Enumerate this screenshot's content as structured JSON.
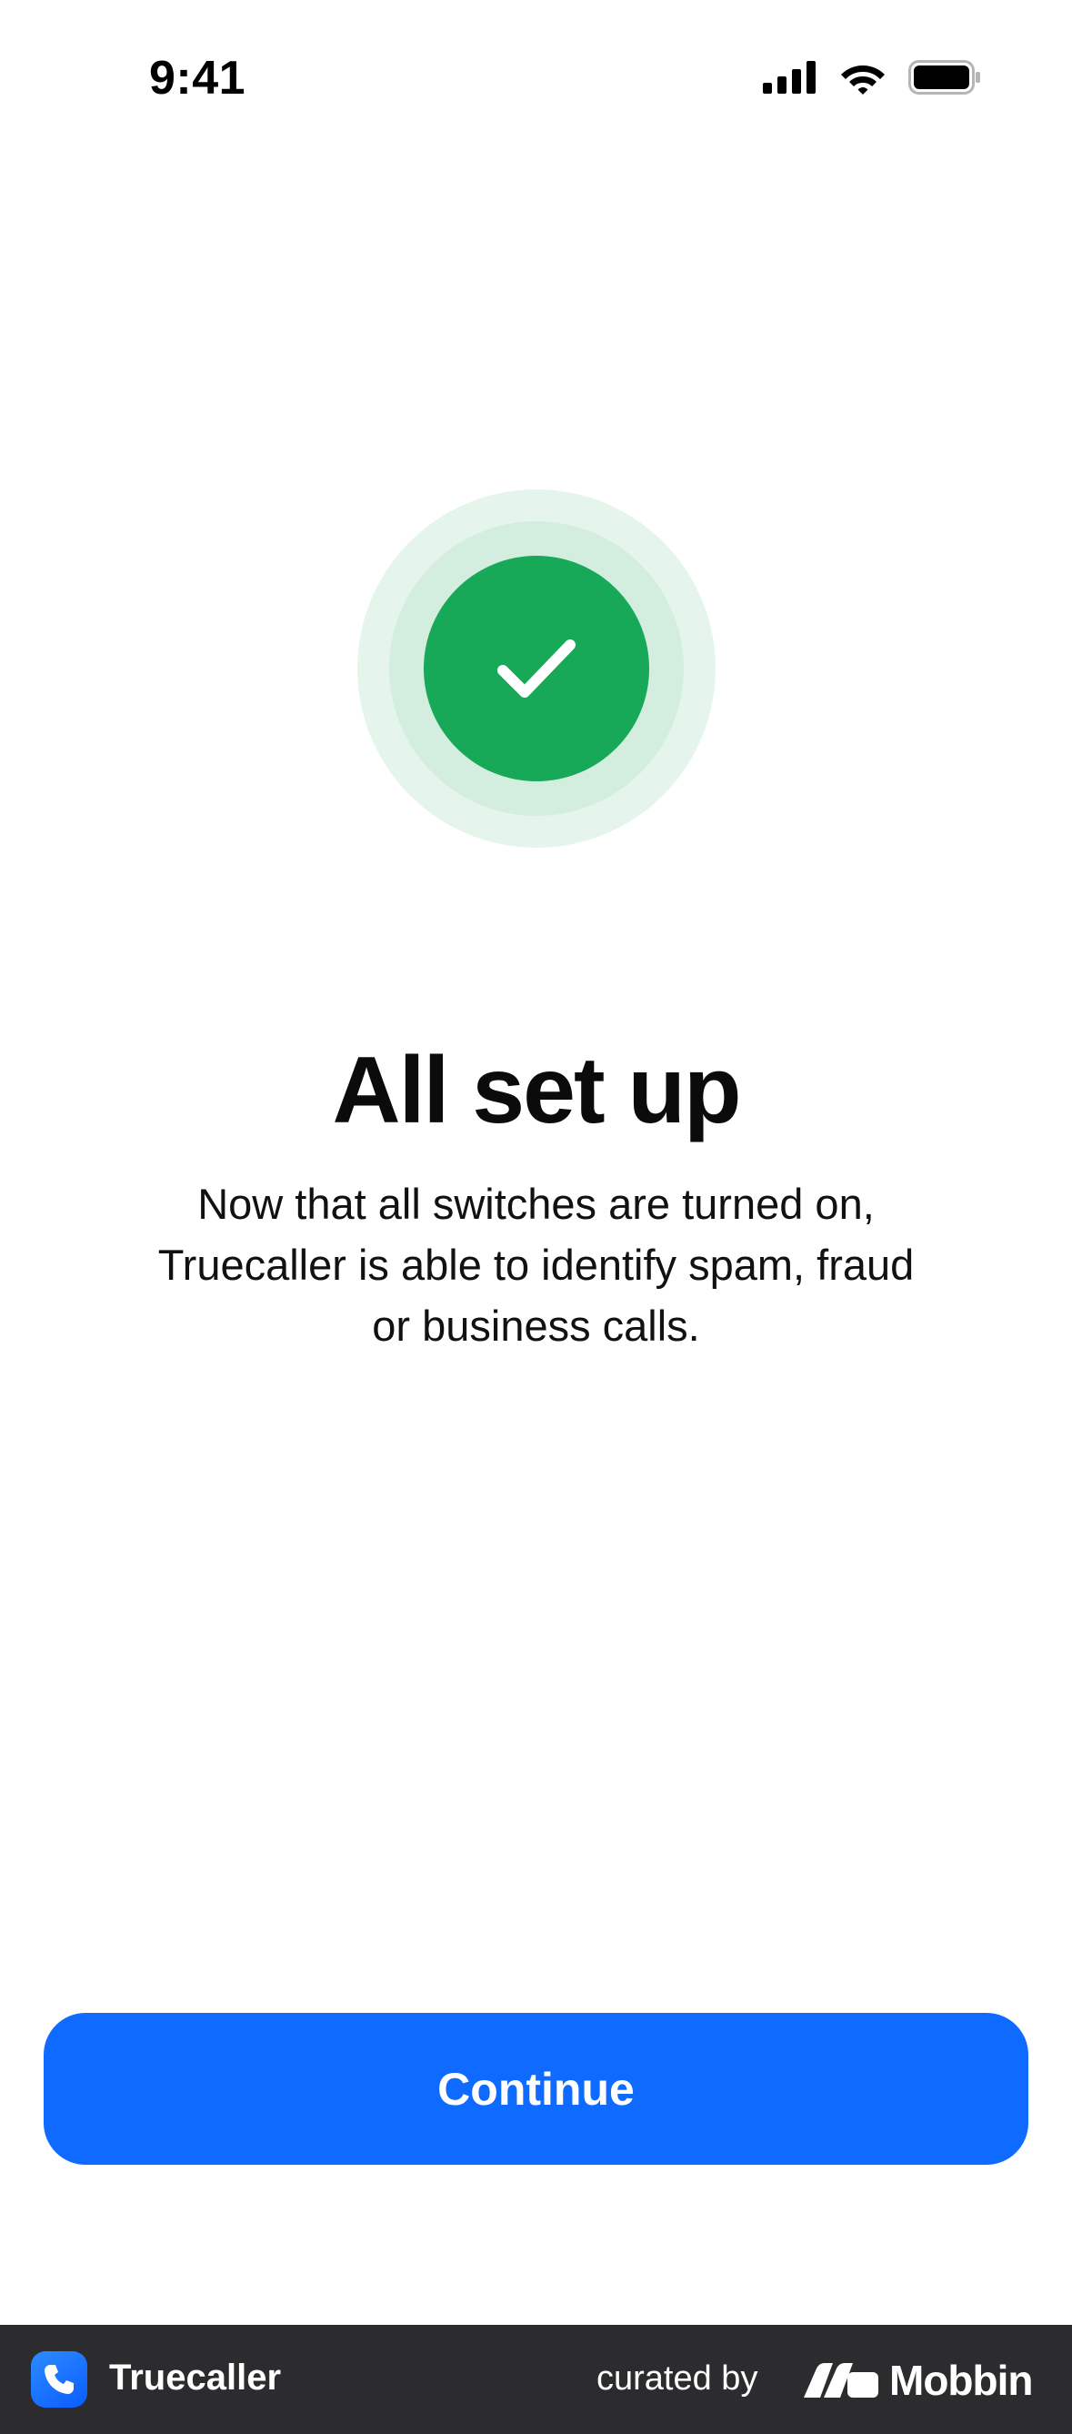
{
  "status_bar": {
    "time": "9:41"
  },
  "success": {
    "icon": "checkmark-icon",
    "colors": {
      "outer_ring": "#e6f5ec",
      "middle_ring": "#d3eedf",
      "circle": "#17a858"
    }
  },
  "content": {
    "title": "All set up",
    "description": "Now that all switches are turned on, Truecaller is able to identify spam, fraud or business calls."
  },
  "actions": {
    "continue_label": "Continue",
    "primary_color": "#0f6bff"
  },
  "footer": {
    "app_name": "Truecaller",
    "curated_by": "curated by",
    "brand": "Mobbin"
  }
}
